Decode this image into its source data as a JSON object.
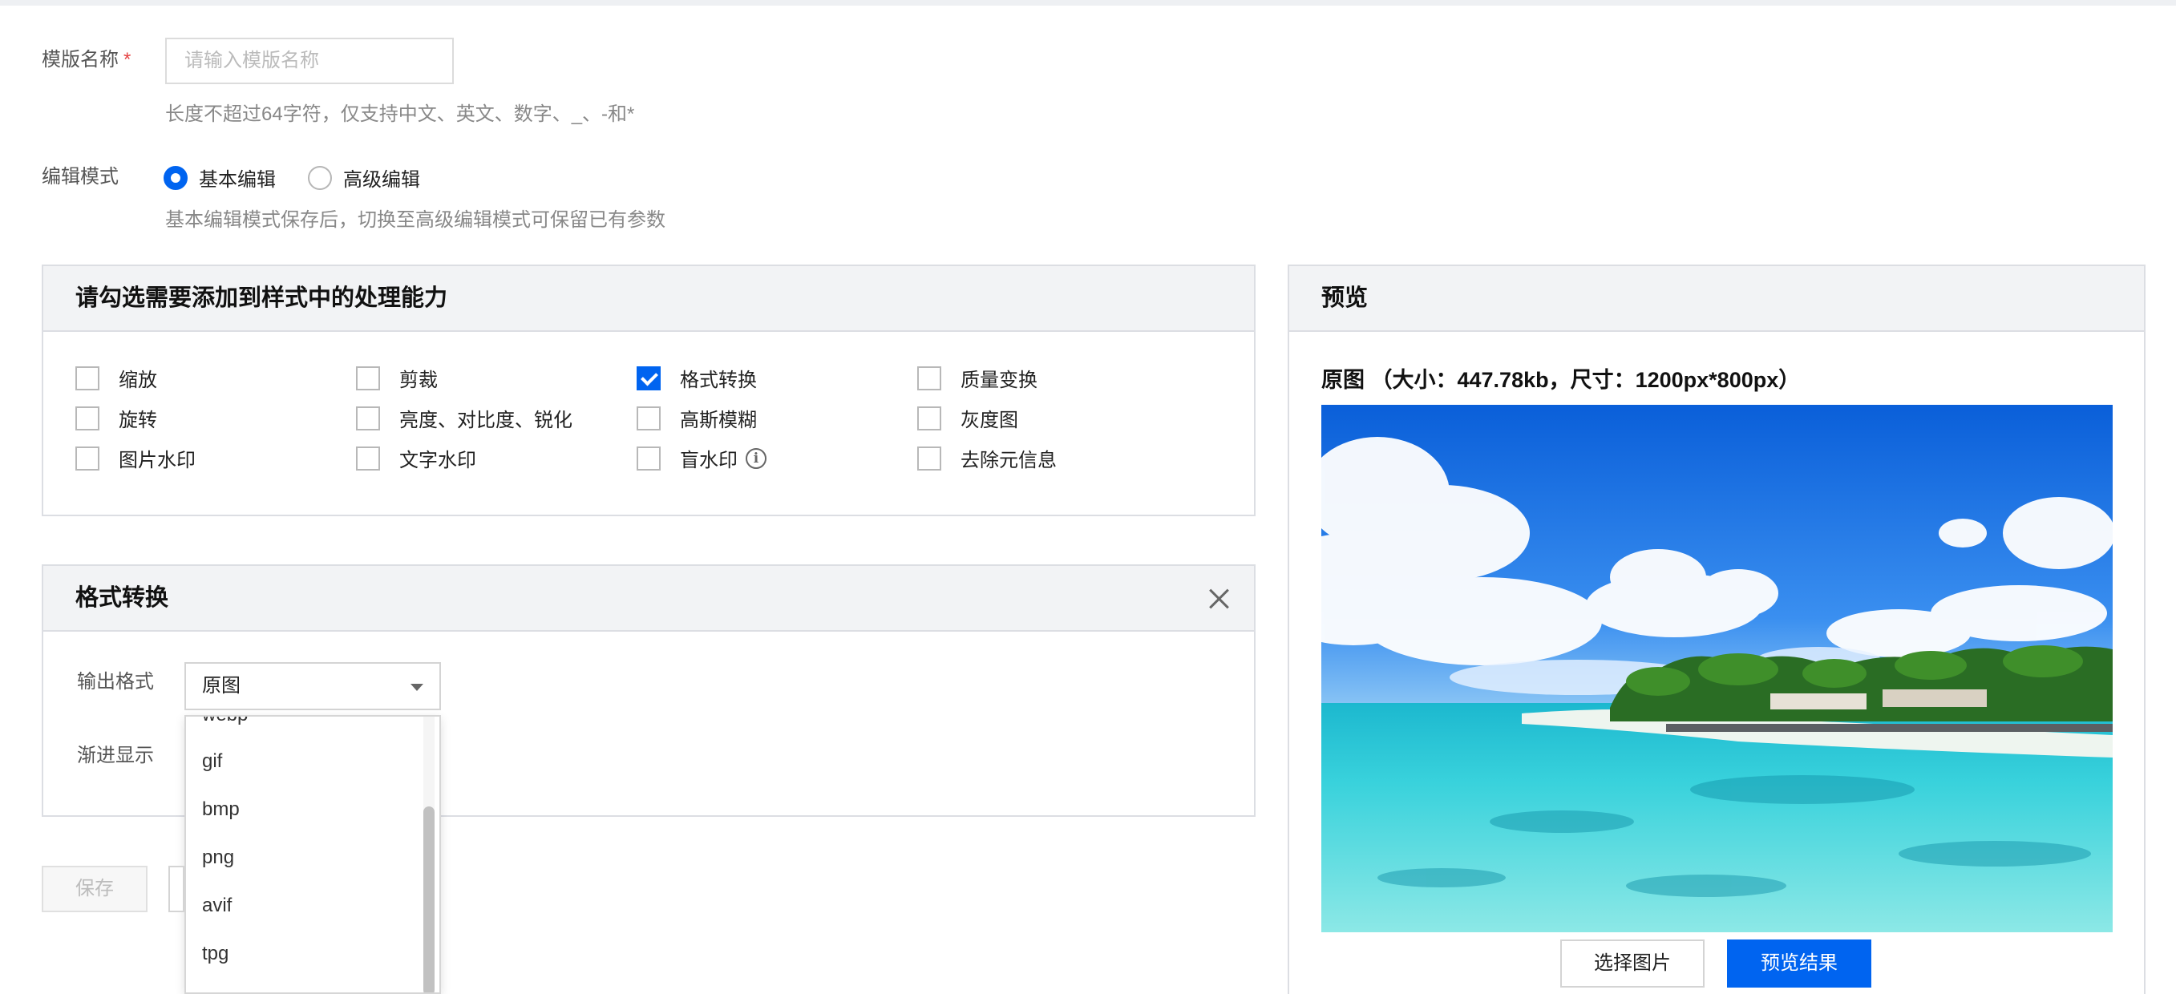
{
  "template_name": {
    "label": "模版名称",
    "required_mark": "*",
    "placeholder": "请输入模版名称",
    "value": "",
    "hint": "长度不超过64字符，仅支持中文、英文、数字、_、-和*"
  },
  "edit_mode": {
    "label": "编辑模式",
    "options": [
      {
        "label": "基本编辑",
        "checked": true
      },
      {
        "label": "高级编辑",
        "checked": false
      }
    ],
    "hint": "基本编辑模式保存后，切换至高级编辑模式可保留已有参数"
  },
  "capabilities": {
    "title": "请勾选需要添加到样式中的处理能力",
    "items": [
      {
        "label": "缩放",
        "checked": false
      },
      {
        "label": "剪裁",
        "checked": false
      },
      {
        "label": "格式转换",
        "checked": true
      },
      {
        "label": "质量变换",
        "checked": false
      },
      {
        "label": "旋转",
        "checked": false
      },
      {
        "label": "亮度、对比度、锐化",
        "checked": false
      },
      {
        "label": "高斯模糊",
        "checked": false
      },
      {
        "label": "灰度图",
        "checked": false
      },
      {
        "label": "图片水印",
        "checked": false
      },
      {
        "label": "文字水印",
        "checked": false
      },
      {
        "label": "盲水印",
        "checked": false,
        "icon": "info-icon"
      },
      {
        "label": "去除元信息",
        "checked": false
      }
    ]
  },
  "format_panel": {
    "title": "格式转换",
    "output_format_label": "输出格式",
    "output_format_value": "原图",
    "progressive_label": "渐进显示",
    "dropdown_options": [
      "webp",
      "gif",
      "bmp",
      "png",
      "avif",
      "tpg"
    ]
  },
  "actions": {
    "save_label": "保存"
  },
  "preview": {
    "title": "预览",
    "original_caption": "原图 （大小：447.78kb，尺寸：1200px*800px）",
    "choose_image_label": "选择图片",
    "preview_result_label": "预览结果"
  },
  "colors": {
    "primary": "#0064f0",
    "required": "#e54545"
  }
}
